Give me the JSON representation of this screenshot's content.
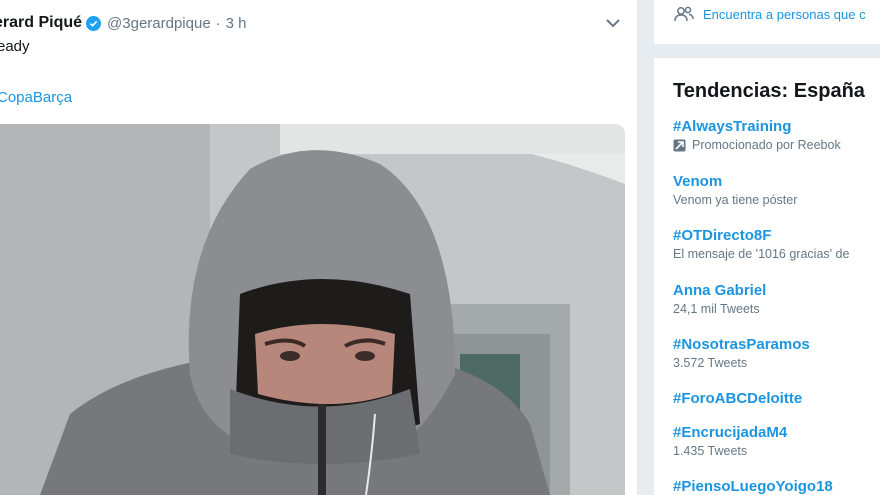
{
  "tweet": {
    "author_name": "erard Piqué",
    "handle": "@3gerardpique",
    "separator": "·",
    "time": "3 h",
    "text": "eady",
    "hashtag": "CopaBarça"
  },
  "sidebar": {
    "who_to_follow": "Encuentra a personas que c",
    "trends_title": "Tendencias: España",
    "trends": [
      {
        "name": "#AlwaysTraining",
        "meta": "Promocionado por Reebok",
        "promoted": true
      },
      {
        "name": "Venom",
        "meta": "Venom ya tiene póster",
        "promoted": false
      },
      {
        "name": "#OTDirecto8F",
        "meta": "El mensaje de '1016 gracias' de",
        "promoted": false
      },
      {
        "name": "Anna Gabriel",
        "meta": "24,1 mil Tweets",
        "promoted": false
      },
      {
        "name": "#NosotrasParamos",
        "meta": "3.572 Tweets",
        "promoted": false
      },
      {
        "name": "#ForoABCDeloitte",
        "meta": "",
        "promoted": false
      },
      {
        "name": "#EncrucijadaM4",
        "meta": "1.435 Tweets",
        "promoted": false
      },
      {
        "name": "#PiensoLuegoYoigo18",
        "meta": "",
        "promoted": false
      }
    ]
  },
  "colors": {
    "link": "#1b95e0",
    "verified": "#1da1f2",
    "muted": "#657786",
    "page_bg": "#e6ecf0"
  },
  "icons": [
    "verified-badge-icon",
    "chevron-down-icon",
    "people-icon",
    "promoted-icon"
  ]
}
